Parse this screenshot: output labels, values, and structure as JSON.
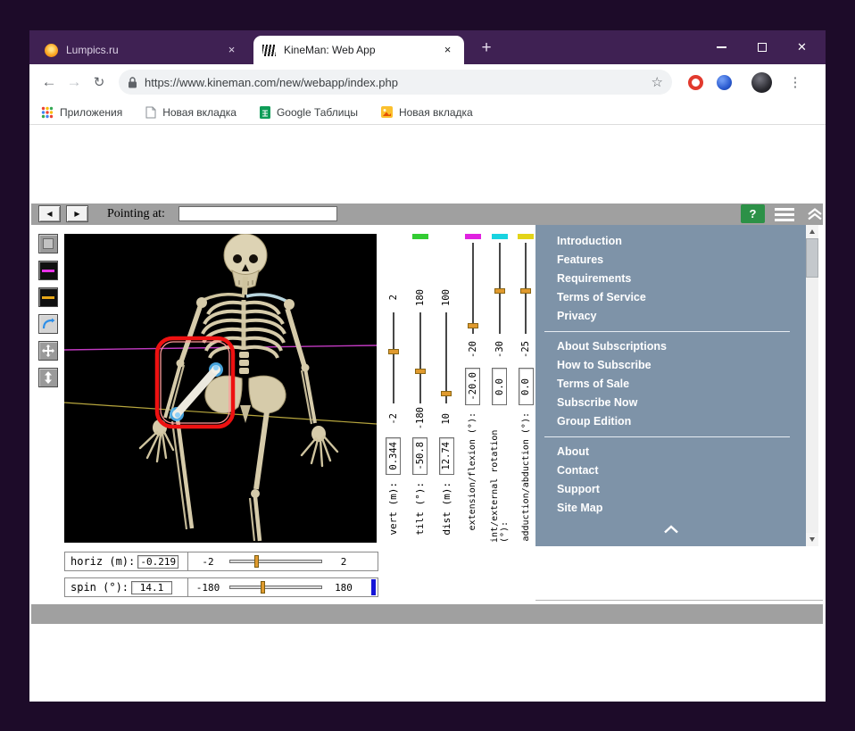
{
  "browser": {
    "tabs": [
      {
        "title": "Lumpics.ru"
      },
      {
        "title": "KineMan: Web App"
      }
    ],
    "url": "https://www.kineman.com/new/webapp/index.php",
    "bookmarks": [
      "Приложения",
      "Новая вкладка",
      "Google Таблицы",
      "Новая вкладка"
    ]
  },
  "icons": {
    "back": "←",
    "forward": "→",
    "reload": "↻",
    "star": "☆",
    "menu_dots": "⋮",
    "new_tab_plus": "+",
    "tab_close": "×",
    "window_close": "✕",
    "help": "?",
    "left_arrow": "◀",
    "right_arrow": "▶"
  },
  "app": {
    "toolbar": {
      "pointing_label": "Pointing at:",
      "pointing_value": ""
    },
    "camera_sliders": [
      {
        "name": "vert (m):",
        "value": "0.344",
        "max": "2",
        "min": "-2",
        "cap_color": "",
        "thumb_pct": 40
      },
      {
        "name": "tilt (°):",
        "value": "-50.8",
        "max": "180",
        "min": "-180",
        "cap_color": "#33cc33",
        "thumb_pct": 62
      },
      {
        "name": "dist (m):",
        "value": "12.74",
        "max": "100",
        "min": "10",
        "cap_color": "",
        "thumb_pct": 86
      }
    ],
    "joint_sliders": [
      {
        "name": "extension/flexion (°):",
        "value": "-20.0",
        "limit": "-20",
        "cap_color": "#e022e0",
        "thumb_pct": 88
      },
      {
        "name": "int/external rotation (°):",
        "value": "0.0",
        "limit": "-30",
        "cap_color": "#19d3e0",
        "thumb_pct": 50
      },
      {
        "name": "adduction/abduction (°):",
        "value": "0.0",
        "limit": "-25",
        "cap_color": "#e3d418",
        "thumb_pct": 50
      }
    ],
    "horizontal_sliders": [
      {
        "name": "horiz (m):",
        "value": "-0.219",
        "min": "-2",
        "max": "2",
        "thumb_pct": 26
      },
      {
        "name": "spin (°):",
        "value": "14.1",
        "min": "-180",
        "max": "180",
        "thumb_pct": 33
      }
    ],
    "colors": {
      "menu_bg": "#7e93a8",
      "help_green": "#2c9147",
      "selection_red": "#ee1111",
      "slider_thumb": "#e09a2e",
      "blue_indicator": "#1515d8",
      "canvas_line_magenta": "#c23ac2",
      "canvas_line_yellow": "#b7a63e",
      "bone": "#d6cbaa",
      "joint_highlight_blue": "#4fb4f2"
    }
  },
  "menu": {
    "sections": [
      {
        "items": [
          "Introduction",
          "Features",
          "Requirements",
          "Terms of Service",
          "Privacy"
        ]
      },
      {
        "items": [
          "About Subscriptions",
          "How to Subscribe",
          "Terms of Sale",
          "Subscribe Now",
          "Group Edition"
        ]
      },
      {
        "items": [
          "About",
          "Contact",
          "Support",
          "Site Map"
        ]
      }
    ]
  }
}
